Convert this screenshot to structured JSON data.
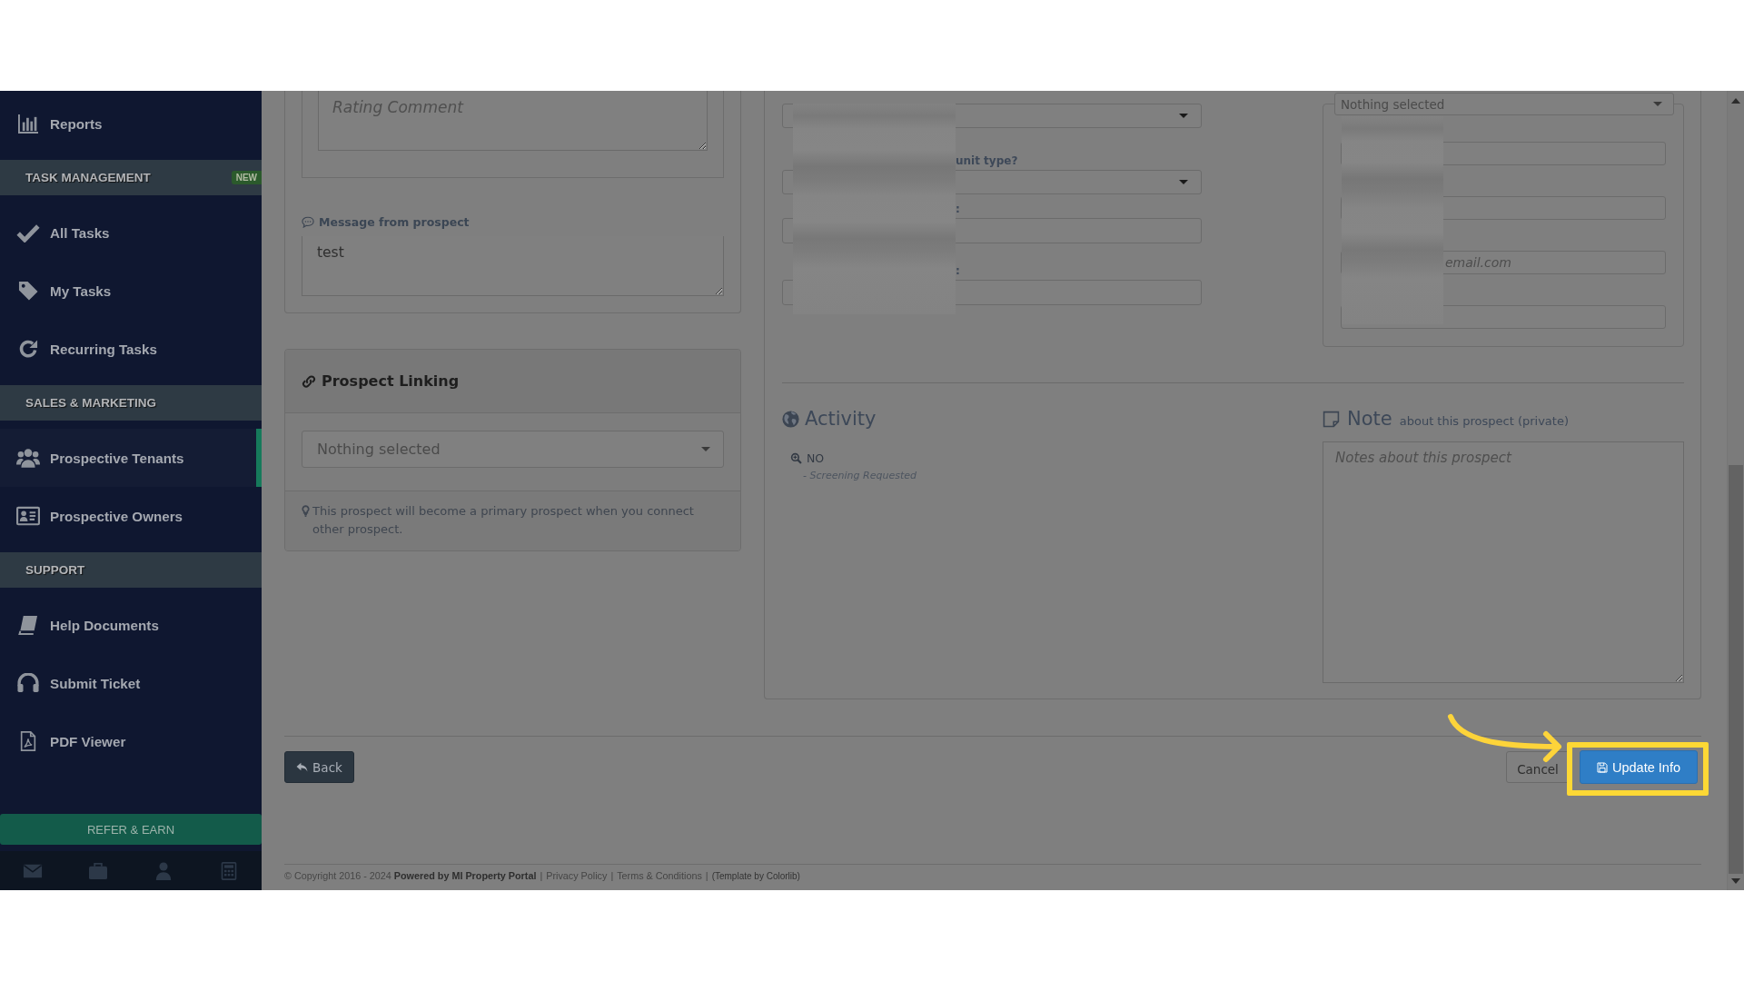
{
  "sidebar": {
    "items": [
      {
        "kind": "link",
        "label": "Reports",
        "selected": false
      },
      {
        "kind": "section",
        "label": "TASK MANAGEMENT",
        "badge": "NEW"
      },
      {
        "kind": "link",
        "label": "All Tasks",
        "selected": false
      },
      {
        "kind": "link",
        "label": "My Tasks",
        "selected": false
      },
      {
        "kind": "link",
        "label": "Recurring Tasks",
        "selected": false
      },
      {
        "kind": "section",
        "label": "SALES & MARKETING"
      },
      {
        "kind": "link",
        "label": "Prospective Tenants",
        "selected": true
      },
      {
        "kind": "link",
        "label": "Prospective Owners",
        "selected": false
      },
      {
        "kind": "section",
        "label": "SUPPORT"
      },
      {
        "kind": "link",
        "label": "Help Documents",
        "selected": false
      },
      {
        "kind": "link",
        "label": "Submit Ticket",
        "selected": false
      },
      {
        "kind": "link",
        "label": "PDF Viewer",
        "selected": false
      }
    ],
    "refer_button": "REFER & EARN"
  },
  "rating": {
    "comment": {
      "placeholder": "Rating Comment"
    }
  },
  "message": {
    "label": "Message from prospect",
    "value": "test"
  },
  "prospect_linking": {
    "title": "Prospect Linking",
    "select": {
      "placeholder": "Nothing selected"
    },
    "hint": "This prospect will become a primary prospect when you connect other prospect."
  },
  "details": {
    "fields": [
      {
        "kind": "select"
      },
      {
        "kind": "select",
        "label": "unit type?"
      },
      {
        "kind": "input",
        "label": ":"
      },
      {
        "kind": "input",
        "label": ":"
      }
    ]
  },
  "contact": {
    "select": {
      "placeholder": "Nothing selected"
    },
    "fields": [
      {
        "kind": "input"
      },
      {
        "kind": "input"
      },
      {
        "kind": "input",
        "placeholder": "email.com"
      },
      {
        "kind": "input"
      }
    ]
  },
  "activity": {
    "title": "Activity",
    "entries": [
      {
        "status": "NO",
        "detail": "- Screening Requested"
      }
    ]
  },
  "note": {
    "title": "Note",
    "subtitle": "about this prospect (private)",
    "placeholder": "Notes about this prospect"
  },
  "actions": [
    {
      "kind": "back",
      "label": "Back",
      "highlighted": false
    },
    {
      "kind": "cancel",
      "label": "Cancel",
      "highlighted": false
    },
    {
      "kind": "primary",
      "label": "Update Info",
      "highlighted": true
    }
  ],
  "footer": [
    {
      "kind": "text",
      "text": "© Copyright 2016 - 2024 **Powered by MI Property Portal**"
    },
    {
      "kind": "separator",
      "text": "|"
    },
    {
      "kind": "link",
      "text": "Privacy Policy"
    },
    {
      "kind": "separator",
      "text": "|"
    },
    {
      "kind": "link",
      "text": "Terms & Conditions"
    },
    {
      "kind": "separator",
      "text": "|"
    },
    {
      "kind": "credit",
      "text": "(Template by Colorlib)"
    }
  ]
}
